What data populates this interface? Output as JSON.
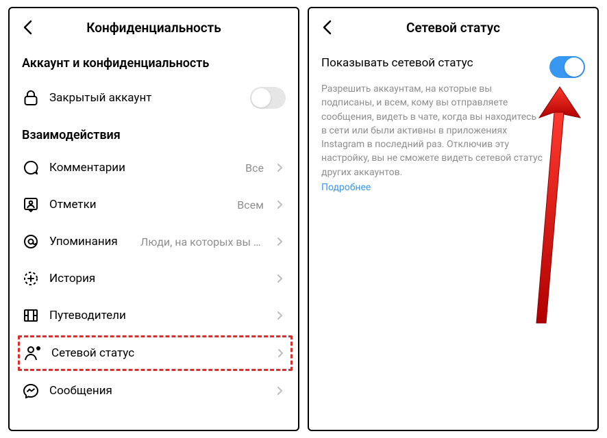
{
  "left": {
    "title": "Конфиденциальность",
    "section_account": "Аккаунт и конфиденциальность",
    "private_account": "Закрытый аккаунт",
    "section_interactions": "Взаимодействия",
    "items": {
      "comments": {
        "label": "Комментарии",
        "value": "Все"
      },
      "tags": {
        "label": "Отметки",
        "value": "Всем"
      },
      "mentions": {
        "label": "Упоминания",
        "value": "Люди, на которых вы п…"
      },
      "story": {
        "label": "История"
      },
      "guides": {
        "label": "Путеводители"
      },
      "activity_status": {
        "label": "Сетевой статус"
      },
      "messages": {
        "label": "Сообщения"
      }
    }
  },
  "right": {
    "title": "Сетевой статус",
    "show_activity_title": "Показывать сетевой статус",
    "show_activity_desc": "Разрешить аккаунтам, на которые вы подписаны, и всем, кому вы отправляете сообщения, видеть в чате, когда вы находитесь в сети или были активны в приложениях Instagram в последний раз. Отключив эту настройку, вы не сможете видеть сетевой статус других аккаунтов.",
    "learn_more": "Подробнее"
  }
}
